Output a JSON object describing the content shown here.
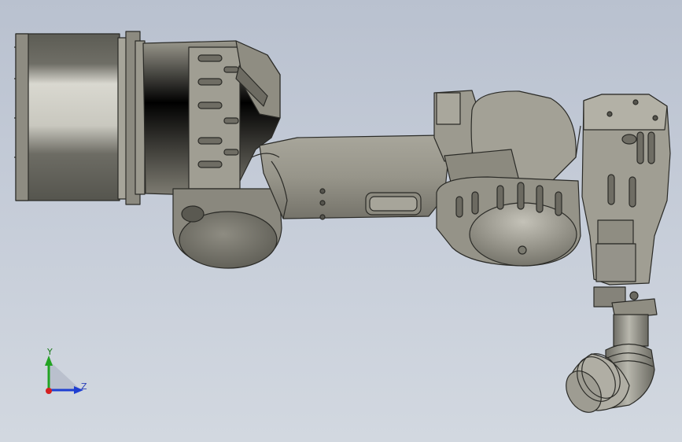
{
  "viewport": {
    "background_top": "#b9c1cf",
    "background_bottom": "#d2d8e0",
    "model_color": "#8d8b80"
  },
  "triad": {
    "y_label": "Y",
    "z_label": "Z",
    "y_color": "#22a322",
    "z_color": "#1f3fd1",
    "x_color": "#d42020"
  }
}
